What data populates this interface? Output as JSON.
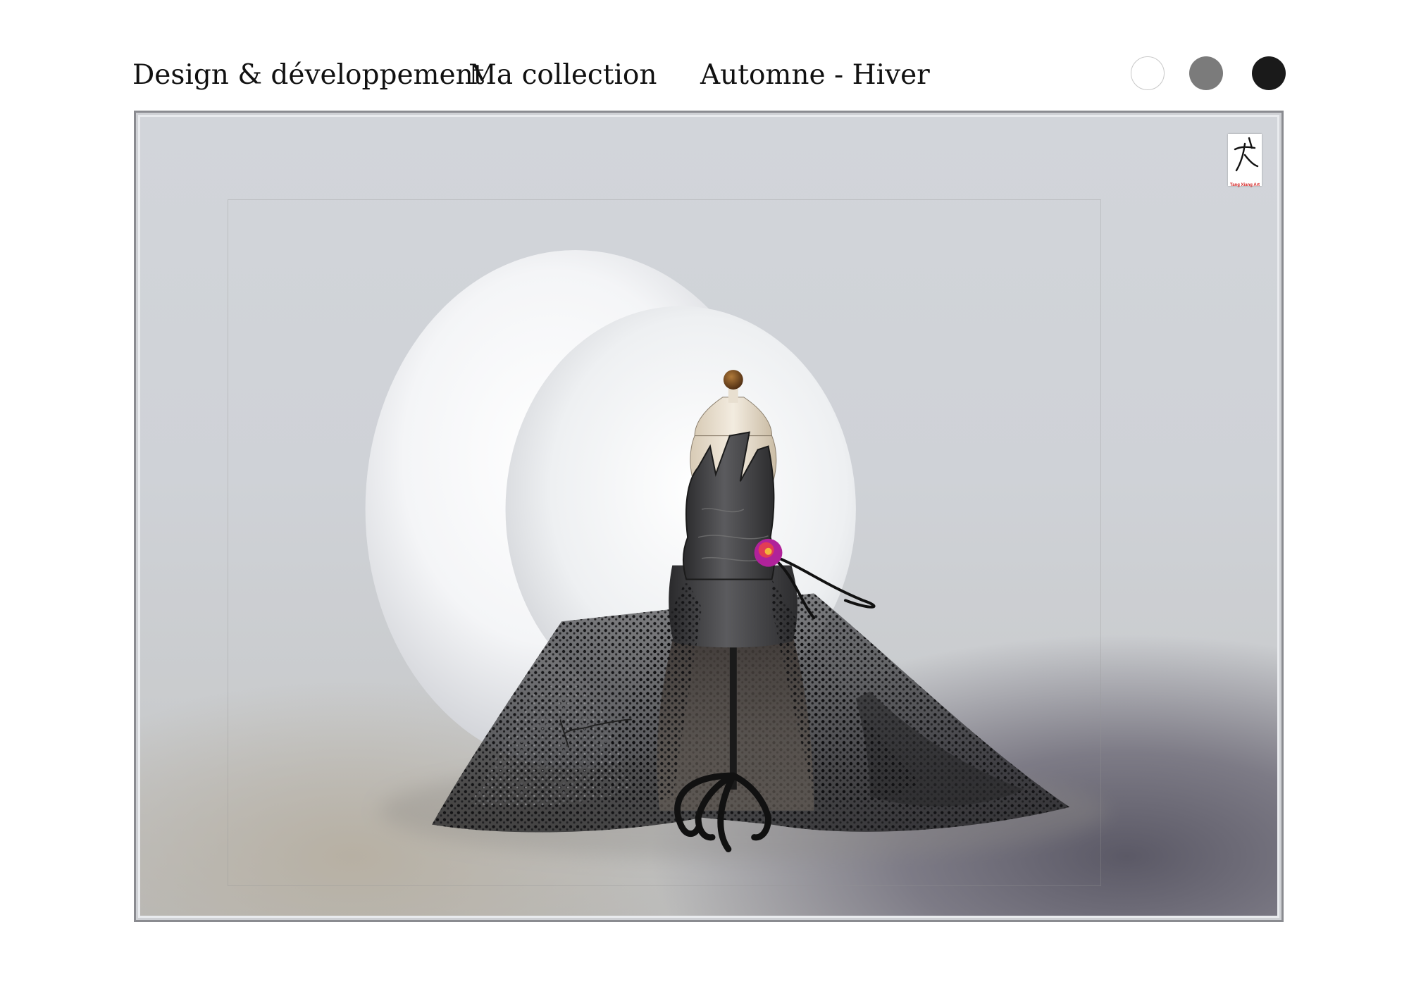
{
  "header": {
    "title_design": "Design & développement",
    "title_collection": "Ma collection",
    "title_season": "Automne - Hiver"
  },
  "swatches": [
    {
      "name": "white",
      "color": "#ffffff"
    },
    {
      "name": "grey",
      "color": "#7b7b7b"
    },
    {
      "name": "black",
      "color": "#1a1a1a"
    }
  ],
  "artwork": {
    "signature": "Xiang",
    "logo_caption": "Tang Xiang Art",
    "flower_color": "#b0229a"
  }
}
